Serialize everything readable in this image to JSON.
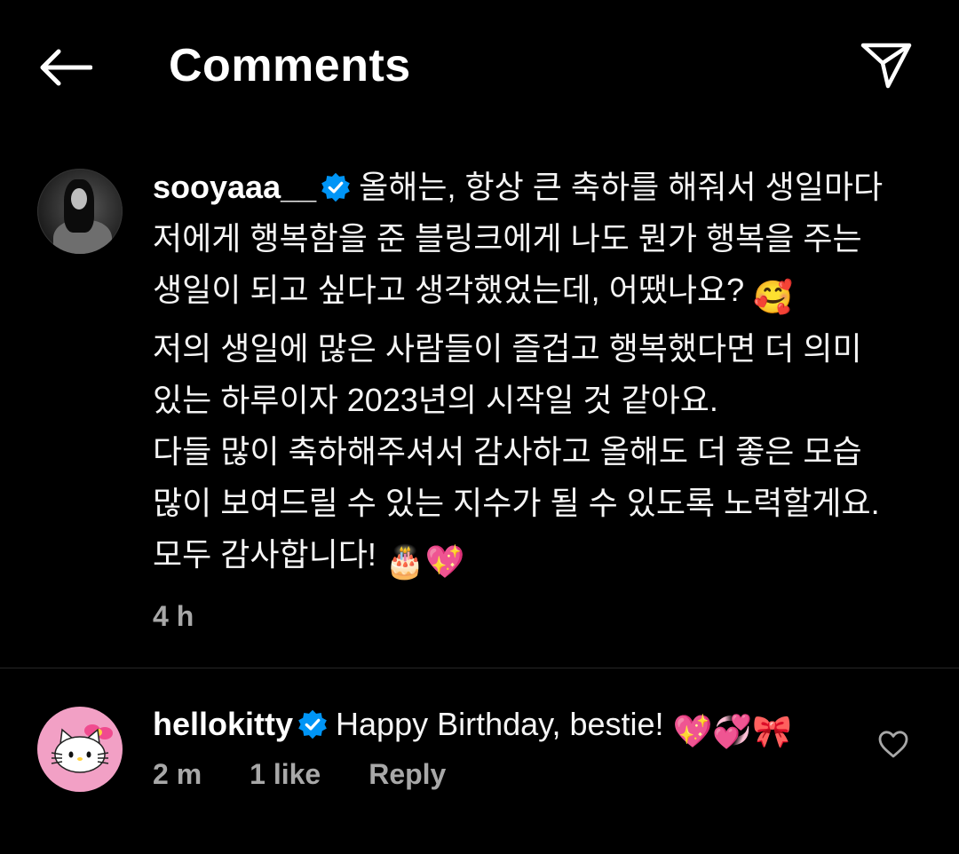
{
  "header": {
    "title": "Comments",
    "back_icon": "arrow-left-icon",
    "share_icon": "paper-plane-icon"
  },
  "caption": {
    "username": "sooyaaa__",
    "verified": true,
    "lines": [
      "올해는, 항상 큰 축하를 해줘서 생일마다 저에게 행복함을 준 블링크에게 나도 뭔가 행복을 주는 생일이 되고 싶다고 생각했었는데, 어땠나요?",
      "저의 생일에 많은 사람들이 즐겁고 행복했다면 더 의미 있는 하루이자 2023년의 시작일 것 같아요.",
      "다들 많이 축하해주셔서 감사하고 올해도 더 좋은 모습 많이 보여드릴 수 있는 지수가 될 수 있도록 노력할게요.",
      "모두 감사합니다!"
    ],
    "emoji_1": "🥰",
    "emoji_2": "🎂💖",
    "time": "4 h"
  },
  "reply": {
    "username": "hellokitty",
    "verified": true,
    "text": "Happy Birthday, bestie!",
    "emoji": "💖💞🎀",
    "time": "2 m",
    "likes": "1 like",
    "reply_label": "Reply"
  },
  "colors": {
    "background": "#000000",
    "text": "#f5f5f5",
    "secondary_text": "#a8a8a8",
    "verified_blue": "#0095f6",
    "divider": "#262626"
  }
}
